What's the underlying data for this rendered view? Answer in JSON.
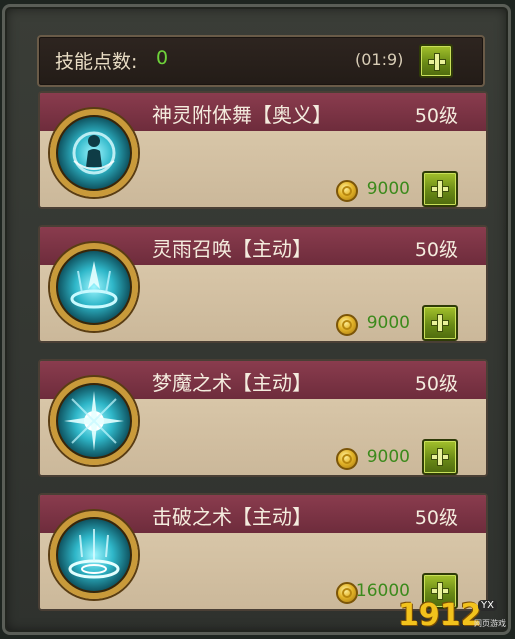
{
  "skill_points": {
    "label": "技能点数:",
    "value": "0",
    "timer": "(01:9)"
  },
  "skills": [
    {
      "name": "神灵附体舞【奥义】",
      "level": "50级",
      "cost": "9000",
      "icon": "spirit-dance-icon"
    },
    {
      "name": "灵雨召唤【主动】",
      "level": "50级",
      "cost": "9000",
      "icon": "spirit-rain-icon"
    },
    {
      "name": "梦魔之术【主动】",
      "level": "50级",
      "cost": "9000",
      "icon": "nightmare-burst-icon"
    },
    {
      "name": "击破之术【主动】",
      "level": "50级",
      "cost": "16000",
      "icon": "break-ripple-icon"
    }
  ],
  "watermark": {
    "logo_text": "1912",
    "badge": "YX",
    "sub": "网页游戏"
  },
  "colors": {
    "accent_green": "#6ed33a",
    "band_red": "#7a3244",
    "gold": "#c99a3a"
  }
}
